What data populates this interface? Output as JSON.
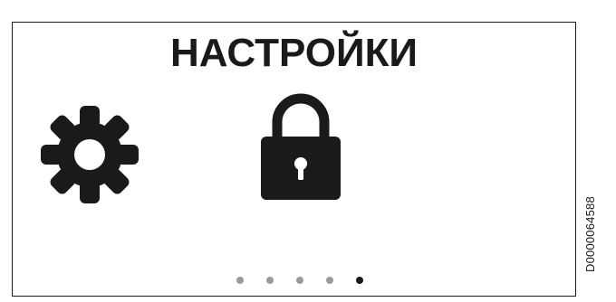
{
  "screen": {
    "title": "НАСТРОЙКИ"
  },
  "icons": {
    "settings": "gear-icon",
    "lock": "lock-icon"
  },
  "pagination": {
    "total": 5,
    "active_index": 4
  },
  "document_code": "D0000064588",
  "colors": {
    "foreground": "#1a1a1a",
    "inactive_dot": "#9a9a9a",
    "background": "#ffffff"
  }
}
